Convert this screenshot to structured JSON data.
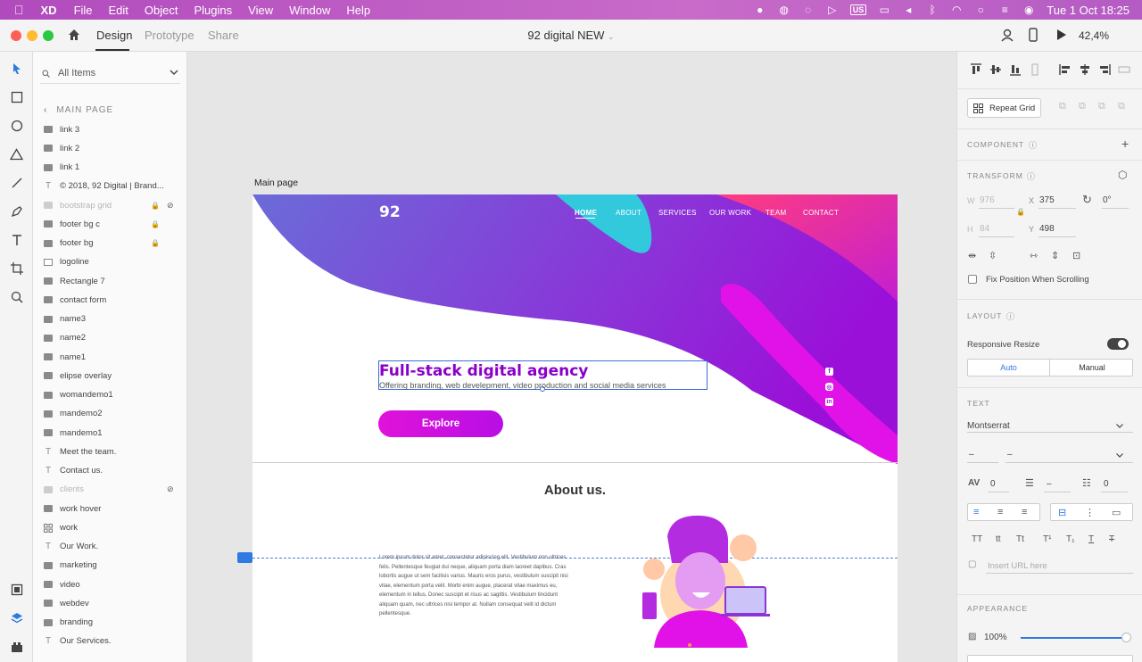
{
  "menubar": {
    "app": "XD",
    "items": [
      "File",
      "Edit",
      "Object",
      "Plugins",
      "View",
      "Window",
      "Help"
    ],
    "clock": "Tue 1 Oct  18:25",
    "badge": "US"
  },
  "titlebar": {
    "tabs": [
      "Design",
      "Prototype",
      "Share"
    ],
    "doc_title": "92 digital NEW",
    "zoom": "42,4%"
  },
  "layers": {
    "search_label": "All Items",
    "back_label": "MAIN PAGE",
    "items": [
      {
        "name": "link 3",
        "icon": "folder"
      },
      {
        "name": "link 2",
        "icon": "folder"
      },
      {
        "name": "link 1",
        "icon": "folder"
      },
      {
        "name": "© 2018, 92 Digital | Brand...",
        "icon": "text"
      },
      {
        "name": "bootstrap grid",
        "icon": "folder",
        "dim": true,
        "lock": true,
        "hidden": true
      },
      {
        "name": "footer bg c",
        "icon": "folder",
        "lock": true
      },
      {
        "name": "footer bg",
        "icon": "folder",
        "lock": true
      },
      {
        "name": "logoline",
        "icon": "img"
      },
      {
        "name": "Rectangle 7",
        "icon": "folder"
      },
      {
        "name": "contact form",
        "icon": "folder"
      },
      {
        "name": "name3",
        "icon": "folder"
      },
      {
        "name": "name2",
        "icon": "folder"
      },
      {
        "name": "name1",
        "icon": "folder"
      },
      {
        "name": "elipse overlay",
        "icon": "folder"
      },
      {
        "name": "womandemo1",
        "icon": "folder"
      },
      {
        "name": "mandemo2",
        "icon": "folder"
      },
      {
        "name": "mandemo1",
        "icon": "folder"
      },
      {
        "name": "Meet the team.",
        "icon": "text"
      },
      {
        "name": "Contact us.",
        "icon": "text"
      },
      {
        "name": "clients",
        "icon": "folder",
        "dim": true,
        "hidden": true
      },
      {
        "name": "work hover",
        "icon": "folder"
      },
      {
        "name": "work",
        "icon": "grid"
      },
      {
        "name": "Our Work.",
        "icon": "text"
      },
      {
        "name": "marketing",
        "icon": "folder"
      },
      {
        "name": "video",
        "icon": "folder"
      },
      {
        "name": "webdev",
        "icon": "folder"
      },
      {
        "name": "branding",
        "icon": "folder"
      },
      {
        "name": "Our Services.",
        "icon": "text"
      }
    ]
  },
  "artboard": {
    "label": "Main page",
    "logo": "92",
    "nav": [
      "HOME",
      "ABOUT",
      "SERVICES",
      "OUR WORK",
      "TEAM",
      "CONTACT"
    ],
    "hero_title": "Full-stack digital agency",
    "hero_sub": "Offering branding, web develepment, video production and social media services",
    "cta": "Explore",
    "about_title": "About us.",
    "lorem": "Lorem ipsum dolor sit amet, consectetur adipiscing elit. Vestibulum non ultrices felis. Pellentesque feugiat dui neque, aliquam porta diam laoreet dapibus. Cras lobortis augue ut sem facilisis varius. Mauris eros purus, vestibulum suscipit nisi vitae, elementum porta velit. Morbi enim augue, placerat vitae maximus eu, elementum in tellus. Donec suscipit et risus ac sagittis. Vestibulum tincidunt aliquam quam, nec ultrices nisi tempor at. Nullam consequat velit id dictum pellentesque."
  },
  "inspector": {
    "repeat_grid": "Repeat Grid",
    "component": "COMPONENT",
    "transform": "TRANSFORM",
    "w_label": "W",
    "w": "976",
    "x_label": "X",
    "x": "375",
    "rotation": "0°",
    "h_label": "H",
    "h": "84",
    "y_label": "Y",
    "y": "498",
    "fix_position": "Fix Position When Scrolling",
    "layout": "LAYOUT",
    "responsive": "Responsive Resize",
    "auto": "Auto",
    "manual": "Manual",
    "text": "TEXT",
    "font": "Montserrat",
    "dash1": "–",
    "dash2": "–",
    "char_spacing": "0",
    "line_spacing": "–",
    "para_spacing": "0",
    "url_placeholder": "Insert URL here",
    "appearance": "APPEARANCE",
    "opacity": "100%"
  },
  "colors": {
    "accent": "#2f7ae0",
    "purple": "#8a00c9",
    "magenta": "#e012d9"
  }
}
